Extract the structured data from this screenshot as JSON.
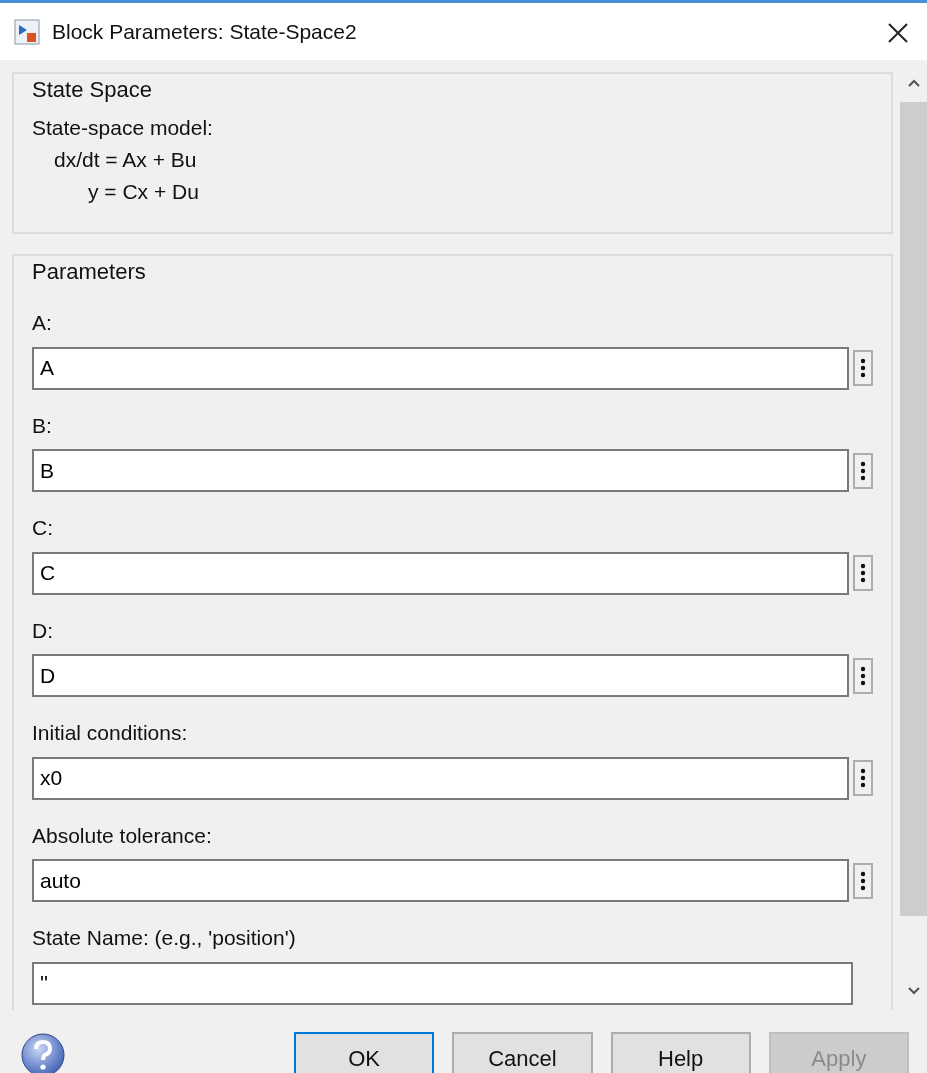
{
  "window": {
    "title": "Block Parameters: State-Space2"
  },
  "description_group": {
    "title": "State Space",
    "lines": [
      "State-space model:",
      "dx/dt = Ax + Bu",
      "y = Cx + Du"
    ]
  },
  "parameters_group": {
    "title": "Parameters",
    "fields": [
      {
        "label": "A:",
        "value": "A",
        "has_ellipsis": true
      },
      {
        "label": "B:",
        "value": "B",
        "has_ellipsis": true
      },
      {
        "label": "C:",
        "value": "C",
        "has_ellipsis": true
      },
      {
        "label": "D:",
        "value": "D",
        "has_ellipsis": true
      },
      {
        "label": "Initial conditions:",
        "value": "x0",
        "has_ellipsis": true
      },
      {
        "label": "Absolute tolerance:",
        "value": "auto",
        "has_ellipsis": true
      },
      {
        "label": "State Name: (e.g., 'position')",
        "value": "''",
        "has_ellipsis": false
      }
    ]
  },
  "buttons": [
    {
      "label": "OK",
      "default": true,
      "disabled": false
    },
    {
      "label": "Cancel",
      "default": false,
      "disabled": false
    },
    {
      "label": "Help",
      "default": false,
      "disabled": false
    },
    {
      "label": "Apply",
      "default": false,
      "disabled": true
    }
  ]
}
